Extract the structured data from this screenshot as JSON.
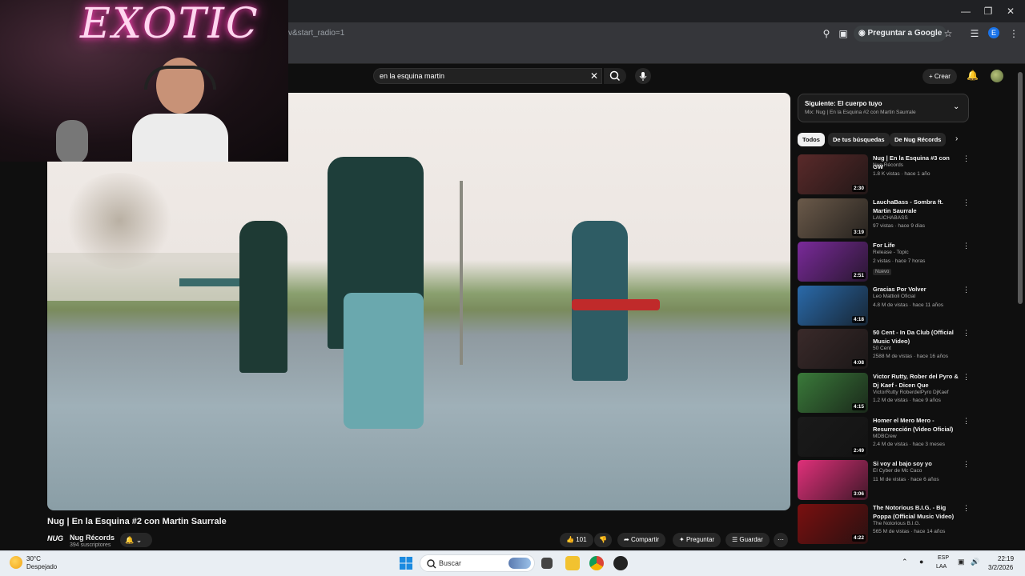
{
  "browser": {
    "url": "v&start_radio=1",
    "ask_google": "Preguntar a Google",
    "profile_letter": "E"
  },
  "webcam": {
    "neon_sign": "EXOTIC"
  },
  "header": {
    "search_value": "en la esquina martin",
    "create_label": "Crear"
  },
  "video": {
    "title": "Nug | En la Esquina #2 con Martin Saurrale",
    "channel_name": "Nug Récords",
    "subscribers": "394 suscriptores",
    "channel_logo": "NUG",
    "likes": "101",
    "share_label": "Compartir",
    "ask_label": "Preguntar",
    "save_label": "Guardar"
  },
  "sidebar": {
    "next_title": "Siguiente: El cuerpo tuyo",
    "next_sub": "Mix: Nug | En la Esquina #2 con Martin Saurrale",
    "chips": [
      "Todos",
      "De tus búsquedas",
      "De Nug Récords"
    ],
    "recs": [
      {
        "title": "Nug | En la Esquina #3 con GW",
        "channel": "Nug Récords",
        "meta": "1.8 K vistas · hace 1 año",
        "duration": "2:30",
        "thumb_color": "#5a2a2a"
      },
      {
        "title": "LauchaBass - Sombra ft. Martin Saurrale",
        "channel": "LAUCHABASS",
        "meta": "97 vistas · hace 9 días",
        "duration": "3:19",
        "thumb_color": "#6b5a4a"
      },
      {
        "title": "For Life",
        "channel": "Release - Topic",
        "meta": "2 vistas · hace 7 horas",
        "duration": "2:51",
        "thumb_color": "#7a2a9a",
        "badge": "Nuevo"
      },
      {
        "title": "Gracias Por Volver",
        "channel": "Leo Mattioli Oficial",
        "meta": "4.8 M de vistas · hace 11 años",
        "duration": "4:18",
        "thumb_color": "#2a6aaa"
      },
      {
        "title": "50 Cent - In Da Club (Official Music Video)",
        "channel": "50 Cent",
        "meta": "2588 M de vistas · hace 16 años",
        "duration": "4:08",
        "thumb_color": "#3a2a2a"
      },
      {
        "title": "Victor Rutty, Rober del Pyro & Dj Kaef - Dicen Que",
        "channel": "VictorRutty RoberdelPyro DjKaef",
        "meta": "1.2 M de vistas · hace 9 años",
        "duration": "4:15",
        "thumb_color": "#3a7a3a"
      },
      {
        "title": "Homer el Mero Mero - Resurrección (Video Oficial)",
        "channel": "MDBCrew",
        "meta": "2.4 M de vistas · hace 3 meses",
        "duration": "2:49",
        "thumb_color": "#1a1a1a"
      },
      {
        "title": "Si voy al bajo soy yo",
        "channel": "El Cyber de Mc Caco",
        "meta": "11 M de vistas · hace 6 años",
        "duration": "3:06",
        "thumb_color": "#e0307a"
      },
      {
        "title": "The Notorious B.I.G. - Big Poppa (Official Music Video)",
        "channel": "The Notorious B.I.G.",
        "meta": "565 M de vistas · hace 14 años",
        "duration": "4:22",
        "thumb_color": "#7a1010"
      }
    ]
  },
  "taskbar": {
    "temperature": "30°C",
    "weather": "Despejado",
    "search_placeholder": "Buscar",
    "lang1": "ESP",
    "lang2": "LAA",
    "time": "22:19",
    "date": "3/2/2026"
  }
}
